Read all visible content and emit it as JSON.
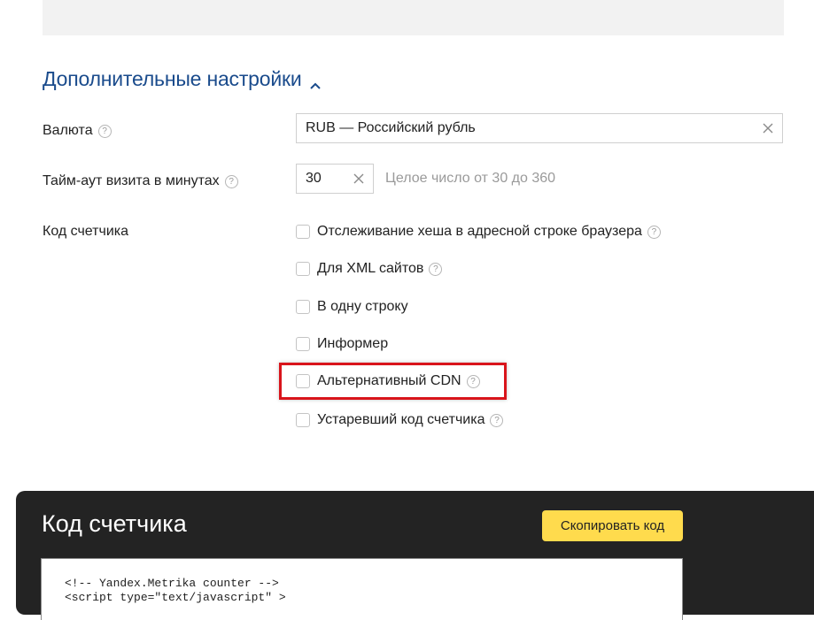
{
  "section": {
    "title": "Дополнительные настройки"
  },
  "currency": {
    "label": "Валюта",
    "value": "RUB — Российский рубль"
  },
  "timeout": {
    "label": "Тайм-аут визита в минутах",
    "value": "30",
    "hint": "Целое число от 30 до 360"
  },
  "counter_code": {
    "label": "Код счетчика",
    "options": [
      {
        "label": "Отслеживание хеша в адресной строке браузера",
        "checked": false,
        "has_help": true
      },
      {
        "label": "Для XML сайтов",
        "checked": false,
        "has_help": true
      },
      {
        "label": "В одну строку",
        "checked": false,
        "has_help": false
      },
      {
        "label": "Информер",
        "checked": false,
        "has_help": false
      },
      {
        "label": "Альтернативный CDN",
        "checked": false,
        "has_help": true
      },
      {
        "label": "Устаревший код счетчика",
        "checked": false,
        "has_help": true
      }
    ]
  },
  "code_panel": {
    "title": "Код счетчика",
    "copy_label": "Скопировать код",
    "code": "<!-- Yandex.Metrika counter -->\n<script type=\"text/javascript\" >"
  },
  "help_glyph": "?",
  "colors": {
    "link": "#1a4b8c",
    "highlight": "#d9141b",
    "copy_button": "#ffdb4d",
    "code_panel_bg": "#232323"
  }
}
